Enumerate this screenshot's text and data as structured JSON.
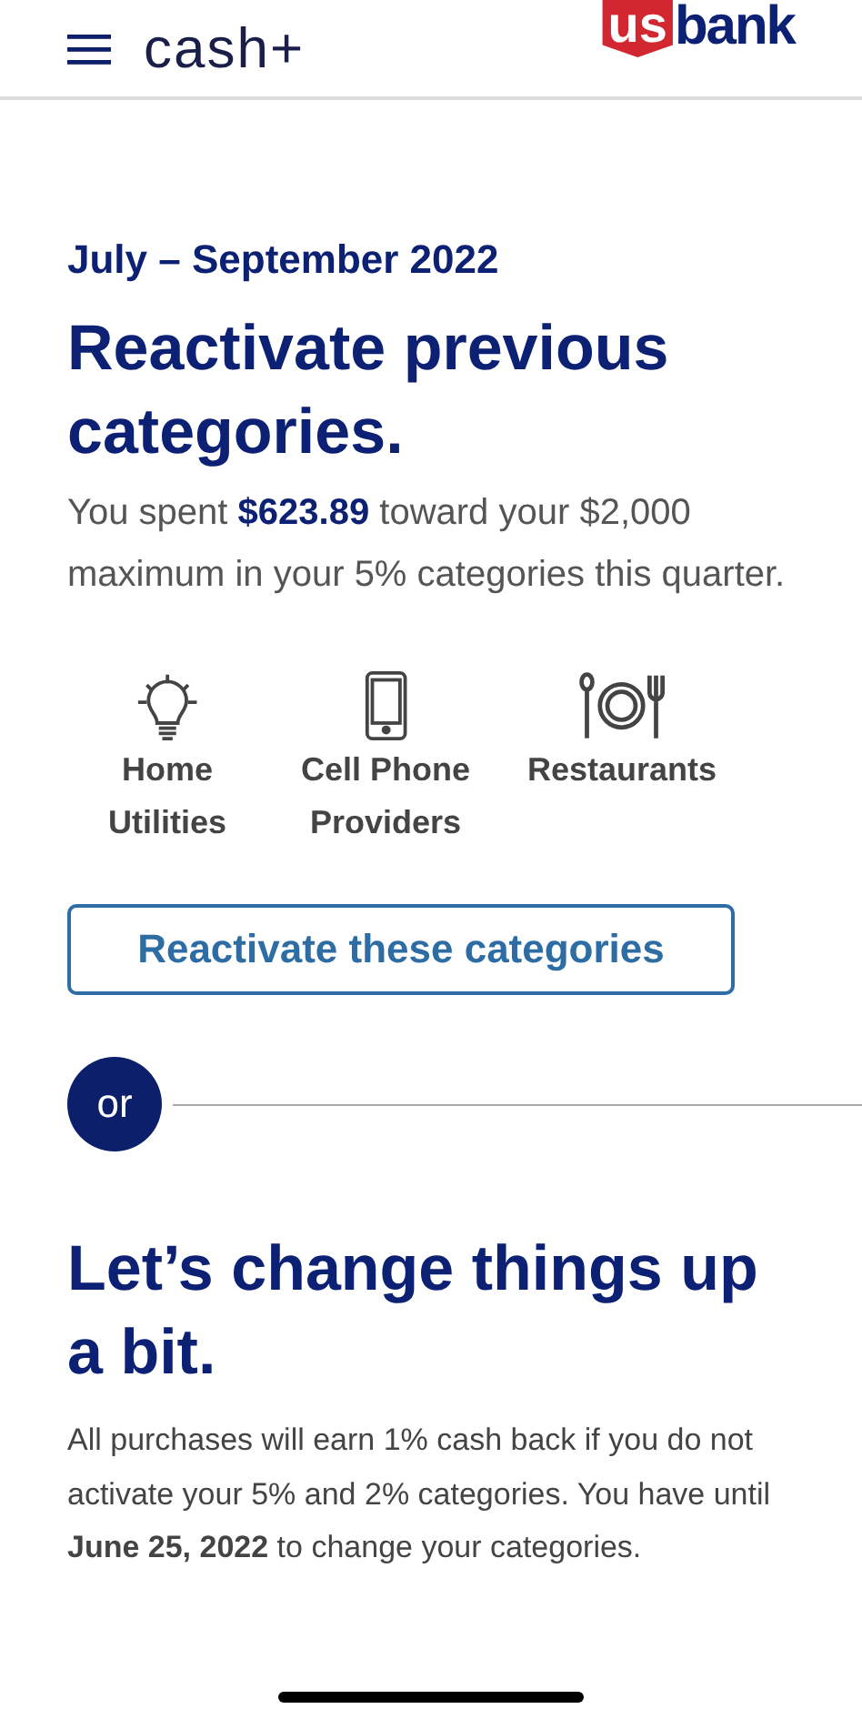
{
  "header": {
    "app_name": "cash+",
    "logo_badge": "us",
    "logo_text": "bank"
  },
  "period": "July – September 2022",
  "heading": "Reactivate previous categories.",
  "summary": "You spent **$623.89** toward your $2,000 maximum in your 5% categories this quarter.",
  "categories": [
    {
      "kind": "bulb",
      "label": "Home Utilities"
    },
    {
      "kind": "phone",
      "label": "Cell Phone Providers"
    },
    {
      "kind": "dining",
      "label": "Restaurants"
    }
  ],
  "reactivate_button": "Reactivate these categories",
  "divider_label": "or",
  "heading_2": "Let’s change things up a bit.",
  "note": "All purchases will earn 1% cash back if you do not activate your 5% and 2% categories. You have until **June 25, 2022** to change your categories."
}
